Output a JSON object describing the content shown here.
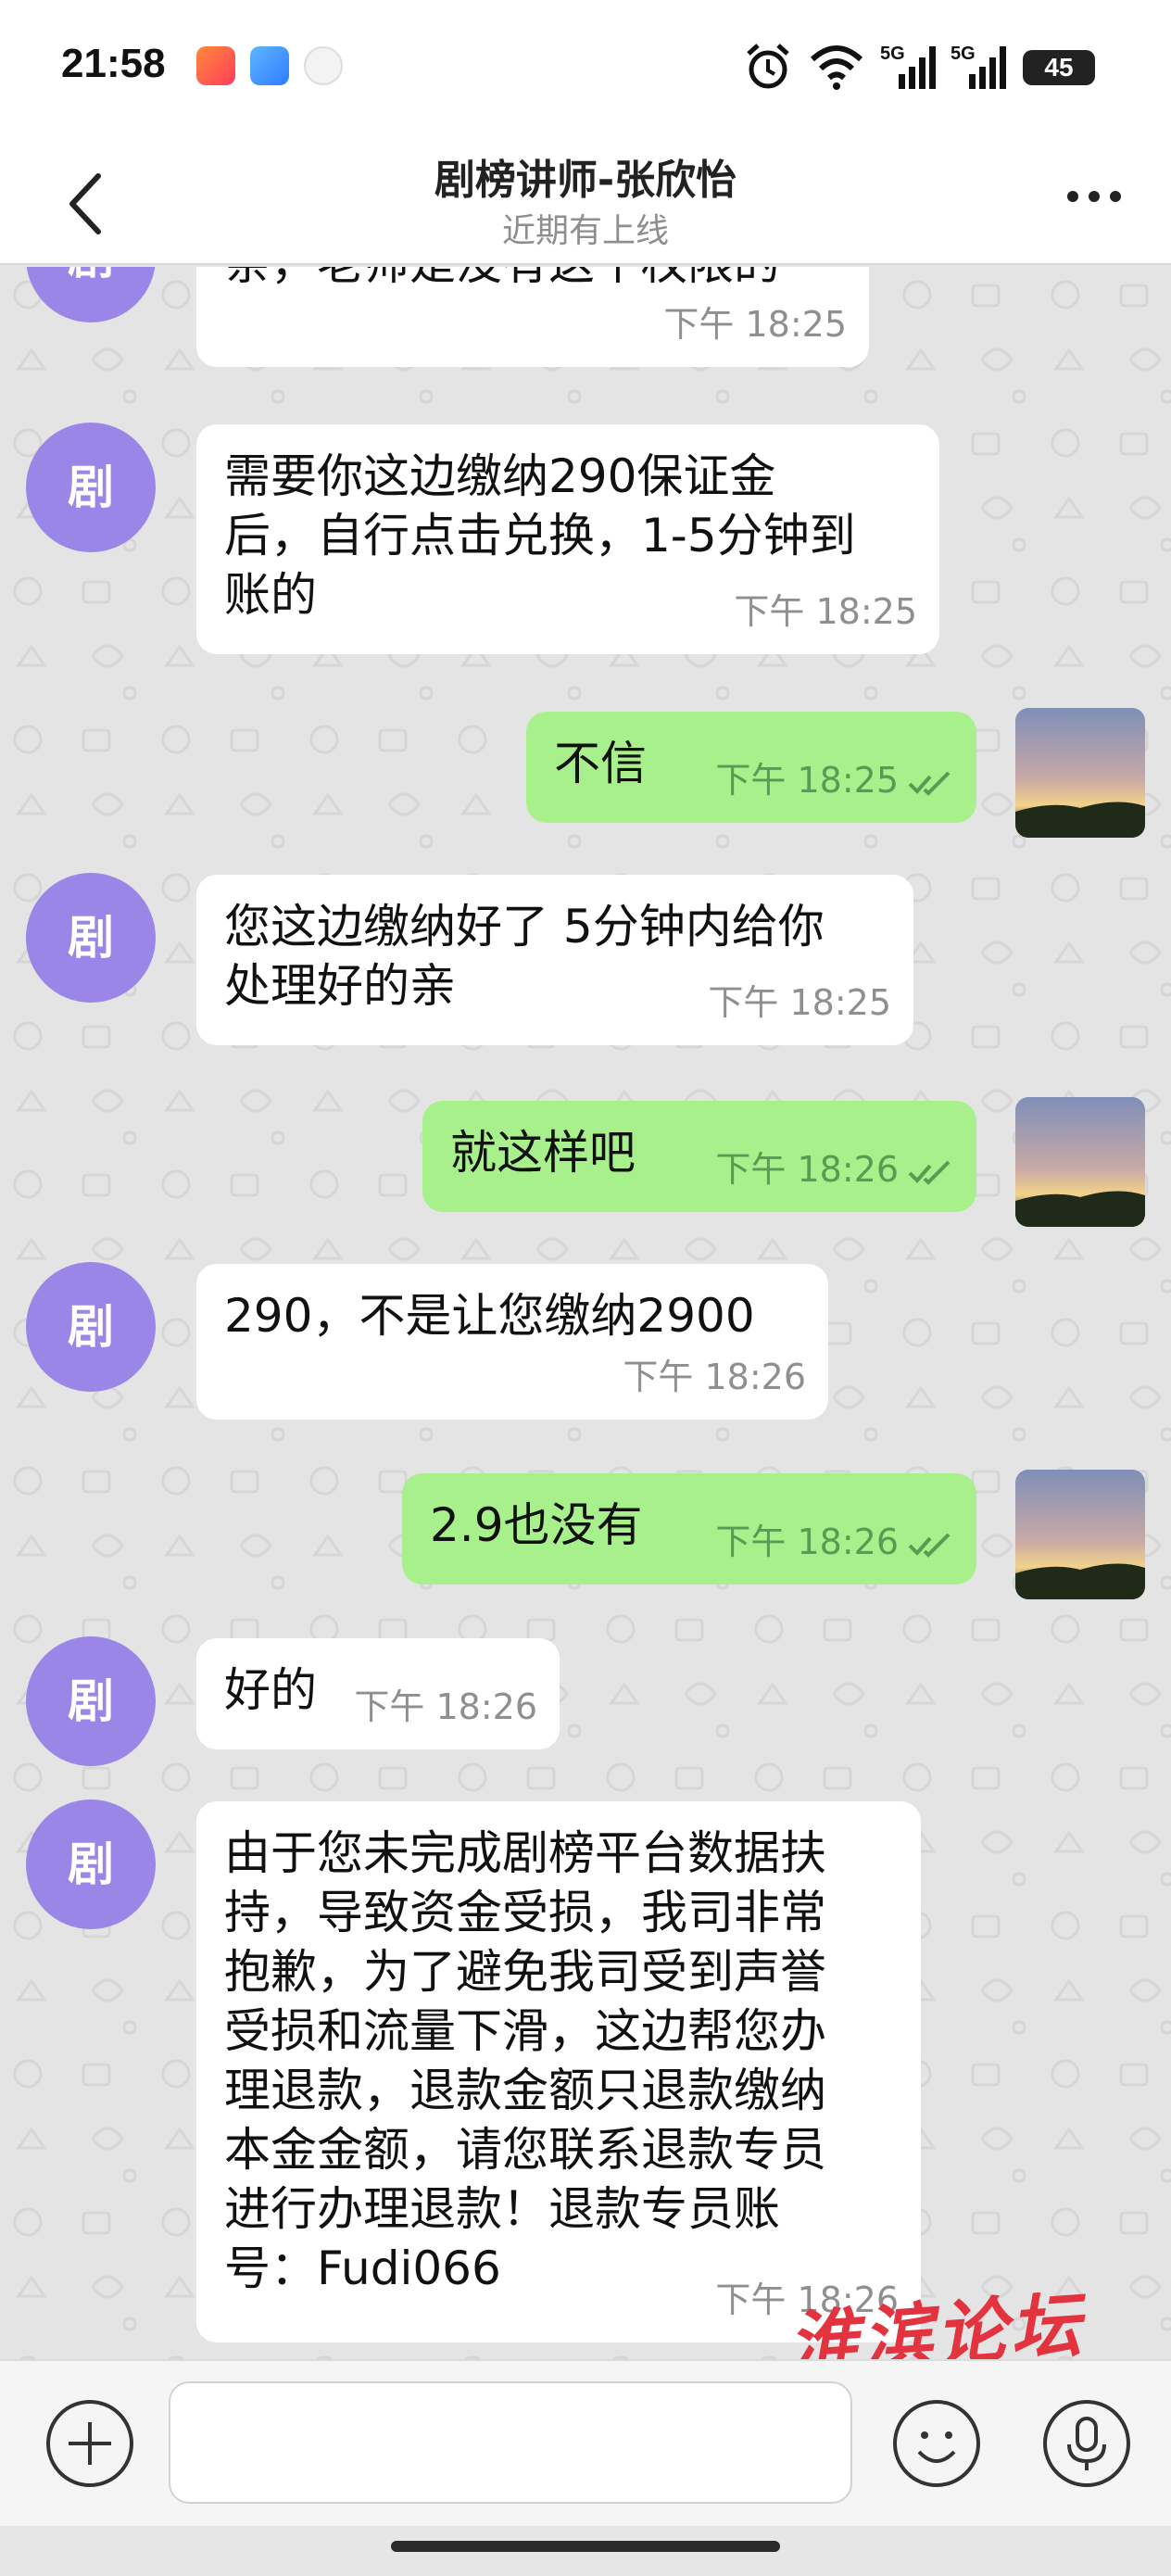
{
  "status_bar": {
    "time": "21:58",
    "battery": "45",
    "icons": [
      "app-badge-icon",
      "cloud-app-icon",
      "realme-icon",
      "alarm-icon",
      "wifi-icon",
      "signal-5g-icon",
      "signal-5g-icon",
      "battery-icon"
    ]
  },
  "header": {
    "title": "剧榜讲师-张欣怡",
    "subtitle": "近期有上线",
    "back_icon": "chevron-left-icon",
    "more_icon": "more-dots-icon"
  },
  "contact": {
    "avatar_char": "剧"
  },
  "messages": [
    {
      "dir": "in",
      "text": "亲，老师是没有这个权限的",
      "time": "下午 18:25"
    },
    {
      "dir": "in",
      "text": "需要你这边缴纳290保证金\n后，自行点击兑换，1-5分钟到\n账的",
      "time": "下午 18:25"
    },
    {
      "dir": "out",
      "text": "不信",
      "time": "下午 18:25"
    },
    {
      "dir": "in",
      "text": "您这边缴纳好了 5分钟内给你\n处理好的亲",
      "time": "下午 18:25"
    },
    {
      "dir": "out",
      "text": "就这样吧",
      "time": "下午 18:26"
    },
    {
      "dir": "in",
      "text": "290，不是让您缴纳2900",
      "time": "下午 18:26"
    },
    {
      "dir": "out",
      "text": "2.9也没有",
      "time": "下午 18:26"
    },
    {
      "dir": "in",
      "text": "好的",
      "time": "下午 18:26"
    },
    {
      "dir": "in",
      "text": "由于您未完成剧榜平台数据扶\n持，导致资金受损，我司非常\n抱歉，为了避免我司受到声誉\n受损和流量下滑，这边帮您办\n理退款，退款金额只退款缴纳\n本金金额，请您联系退款专员\n进行办理退款！退款专员账\n号：Fudi066",
      "time": "下午 18:26"
    }
  ],
  "input_bar": {
    "placeholder": "",
    "add_icon": "plus-icon",
    "emoji_icon": "smiley-icon",
    "mic_icon": "microphone-icon"
  },
  "watermark": "淮滨论坛",
  "colors": {
    "incoming_bubble": "#ffffff",
    "outgoing_bubble": "#a8f08b",
    "avatar": "#9a86e6",
    "watermark": "#e2333f"
  }
}
